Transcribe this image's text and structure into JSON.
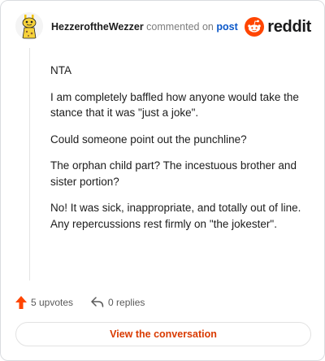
{
  "header": {
    "username": "HezzeroftheWezzer",
    "action_text": "commented on",
    "post_link": "post",
    "brand_wordmark": "reddit",
    "brand_color": "#ff4500"
  },
  "comment": {
    "paragraphs": [
      "NTA",
      "I am completely baffled how anyone would take the stance that it was \"just a joke\".",
      "Could someone point out the punchline?",
      "The orphan child part? The incestuous brother and sister portion?",
      "No! It was sick, inappropriate, and totally out of line. Any repercussions rest firmly on \"the jokester\"."
    ]
  },
  "footer": {
    "upvotes_label": "5 upvotes",
    "replies_label": "0 replies",
    "view_button": "View the conversation",
    "accent_color": "#d93a00"
  },
  "icons": {
    "avatar": "avatar-icon",
    "logo": "reddit-logo-icon",
    "upvote": "upvote-arrow-icon",
    "reply": "reply-arrow-icon"
  }
}
